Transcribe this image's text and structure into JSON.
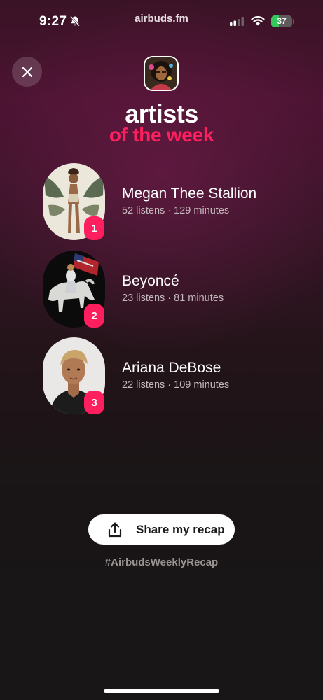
{
  "status_bar": {
    "time": "9:27",
    "url": "airbuds.fm",
    "battery": "37",
    "battery_level": 0.37,
    "icons": [
      "bell-slash-icon",
      "signal-icon",
      "wifi-icon",
      "battery-icon"
    ]
  },
  "header": {
    "close_icon": "close-icon",
    "title": "artists",
    "subtitle": "of the week"
  },
  "artists": [
    {
      "rank": "1",
      "name": "Megan Thee Stallion",
      "stats": "52 listens · 129 minutes"
    },
    {
      "rank": "2",
      "name": "Beyoncé",
      "stats": "23 listens · 81 minutes"
    },
    {
      "rank": "3",
      "name": "Ariana DeBose",
      "stats": "22 listens · 109 minutes"
    }
  ],
  "share": {
    "label": "Share my recap",
    "icon": "share-icon",
    "hashtag": "#AirbudsWeeklyRecap"
  },
  "colors": {
    "accent": "#ff1f5e",
    "background_top": "#4a1330",
    "background_bottom": "#181616"
  }
}
